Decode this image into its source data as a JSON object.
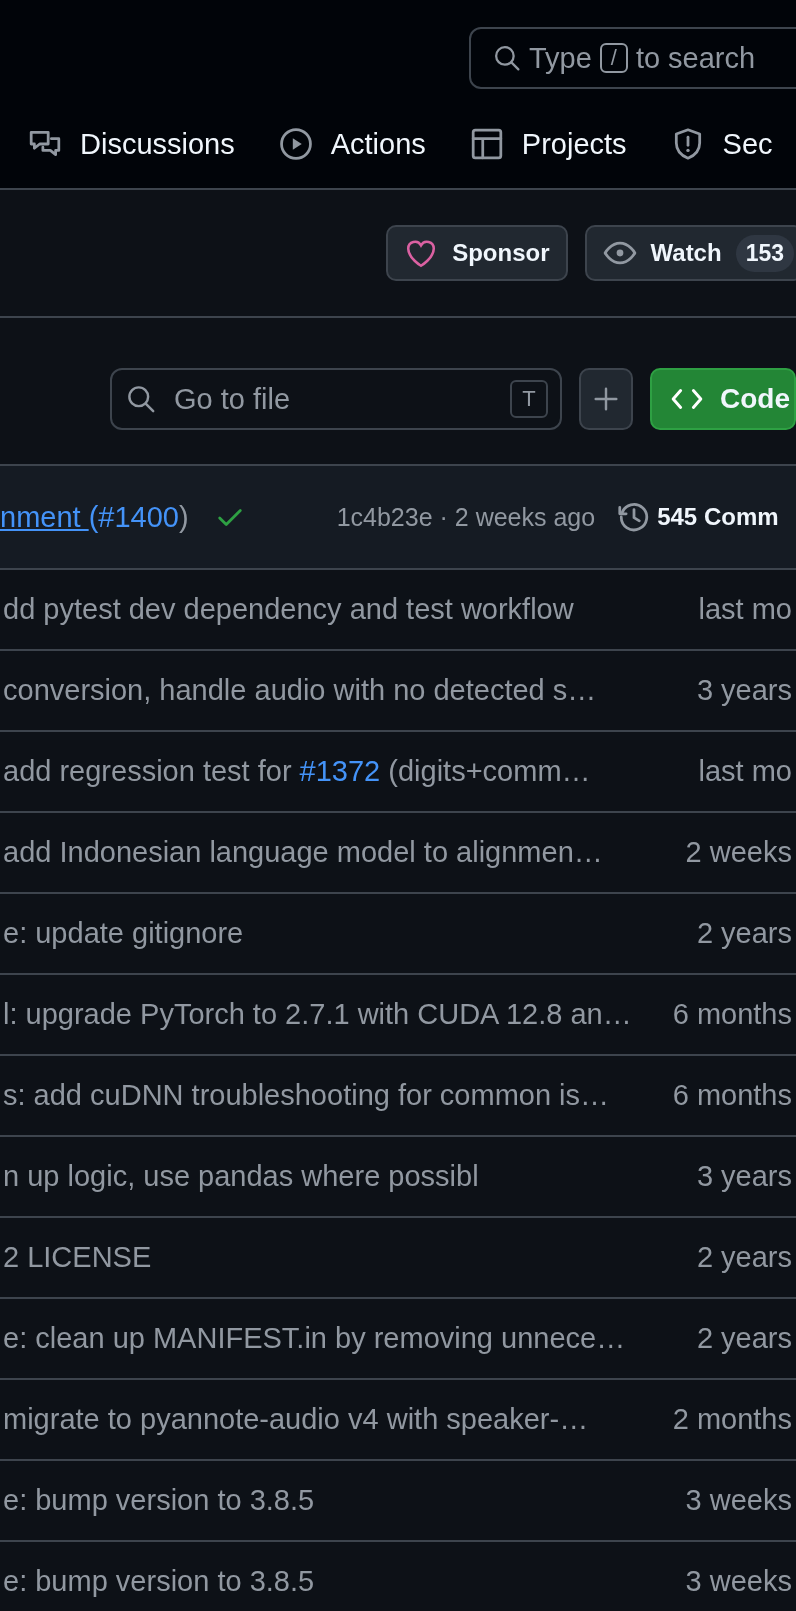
{
  "header": {
    "search": {
      "before": "Type",
      "key": "/",
      "after": "to search"
    },
    "nav": [
      {
        "label": "Discussions"
      },
      {
        "label": "Actions"
      },
      {
        "label": "Projects"
      },
      {
        "label": "Sec"
      }
    ]
  },
  "repo_actions": {
    "sponsor": {
      "label": "Sponsor"
    },
    "watch": {
      "label": "Watch",
      "count": "153"
    }
  },
  "file_bar": {
    "go_to_file": {
      "placeholder": "Go to file",
      "shortcut": "T"
    },
    "code_button": {
      "label": "Code"
    }
  },
  "latest_commit": {
    "message": [
      {
        "kind": "underlined_link",
        "text": "nment "
      },
      {
        "kind": "link",
        "text": "(#1400"
      },
      {
        "kind": "text",
        "text": ")"
      }
    ],
    "sha": "1c4b23e",
    "separator": "·",
    "time": "2 weeks ago",
    "commits": "545 Comm"
  },
  "rows": [
    {
      "message": [
        {
          "kind": "text",
          "text": "dd pytest dev dependency and test workflow"
        }
      ],
      "time": "last mo"
    },
    {
      "message": [
        {
          "kind": "text",
          "text": "conversion, handle audio with no detected s…"
        }
      ],
      "time": "3 years"
    },
    {
      "message": [
        {
          "kind": "text",
          "text": "add regression test for "
        },
        {
          "kind": "link",
          "text": "#1372"
        },
        {
          "kind": "text",
          "text": " (digits+comm…"
        }
      ],
      "time": "last mo"
    },
    {
      "message": [
        {
          "kind": "text",
          "text": "add Indonesian language model to alignmen…"
        }
      ],
      "time": "2 weeks"
    },
    {
      "message": [
        {
          "kind": "text",
          "text": "e: update gitignore"
        }
      ],
      "time": "2 years"
    },
    {
      "message": [
        {
          "kind": "text",
          "text": "l: upgrade PyTorch to 2.7.1 with CUDA 12.8 an…"
        }
      ],
      "time": "6 months"
    },
    {
      "message": [
        {
          "kind": "text",
          "text": "s: add cuDNN troubleshooting for common is…"
        }
      ],
      "time": "6 months"
    },
    {
      "message": [
        {
          "kind": "text",
          "text": "n up logic, use pandas where possibl"
        }
      ],
      "time": "3 years"
    },
    {
      "message": [
        {
          "kind": "text",
          "text": "2 LICENSE"
        }
      ],
      "time": "2 years"
    },
    {
      "message": [
        {
          "kind": "text",
          "text": "e: clean up MANIFEST.in by removing unnece…"
        }
      ],
      "time": "2 years"
    },
    {
      "message": [
        {
          "kind": "text",
          "text": "migrate to pyannote-audio v4 with speaker-…"
        }
      ],
      "time": "2 months"
    },
    {
      "message": [
        {
          "kind": "text",
          "text": "e: bump version to 3.8.5"
        }
      ],
      "time": "3 weeks"
    },
    {
      "message": [
        {
          "kind": "text",
          "text": "e: bump version to 3.8.5"
        }
      ],
      "time": "3 weeks"
    }
  ]
}
